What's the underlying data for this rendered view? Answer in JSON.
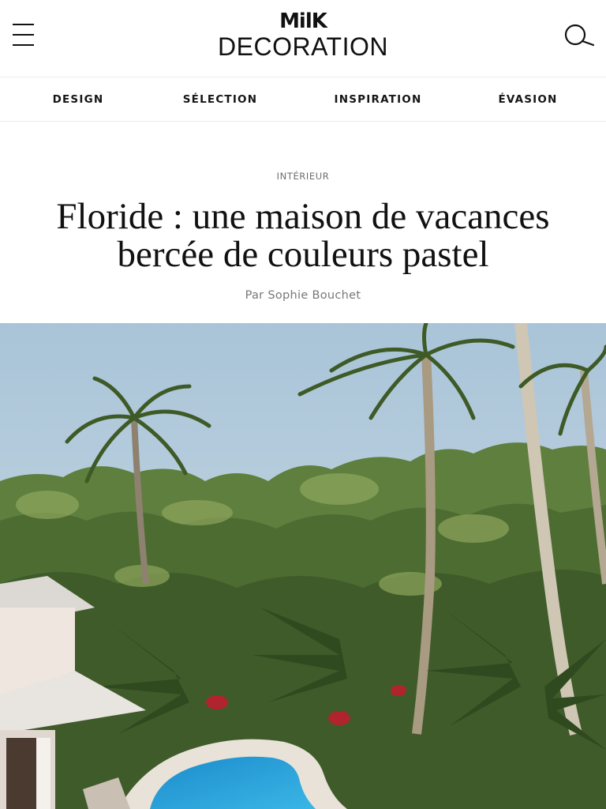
{
  "header": {
    "menu_icon": "hamburger-menu-icon",
    "logo_top": "MilK",
    "logo_bottom": "DECORATION",
    "search_icon": "search-icon"
  },
  "nav": {
    "items": [
      {
        "label": "DESIGN"
      },
      {
        "label": "SÉLECTION"
      },
      {
        "label": "INSPIRATION"
      },
      {
        "label": "ÉVASION"
      }
    ]
  },
  "article": {
    "category": "INTÉRIEUR",
    "title_line1": "Floride : une maison de vacances",
    "title_line2": "bercée de couleurs pastel",
    "byline": "Par Sophie Bouchet",
    "hero_image": "photo of tropical garden with palm trees, house and swimming pool"
  },
  "colors": {
    "text": "#111111",
    "muted": "#777777",
    "divider": "#ececec",
    "sky": "#b9d0e0",
    "pool": "#2ea3d9"
  }
}
